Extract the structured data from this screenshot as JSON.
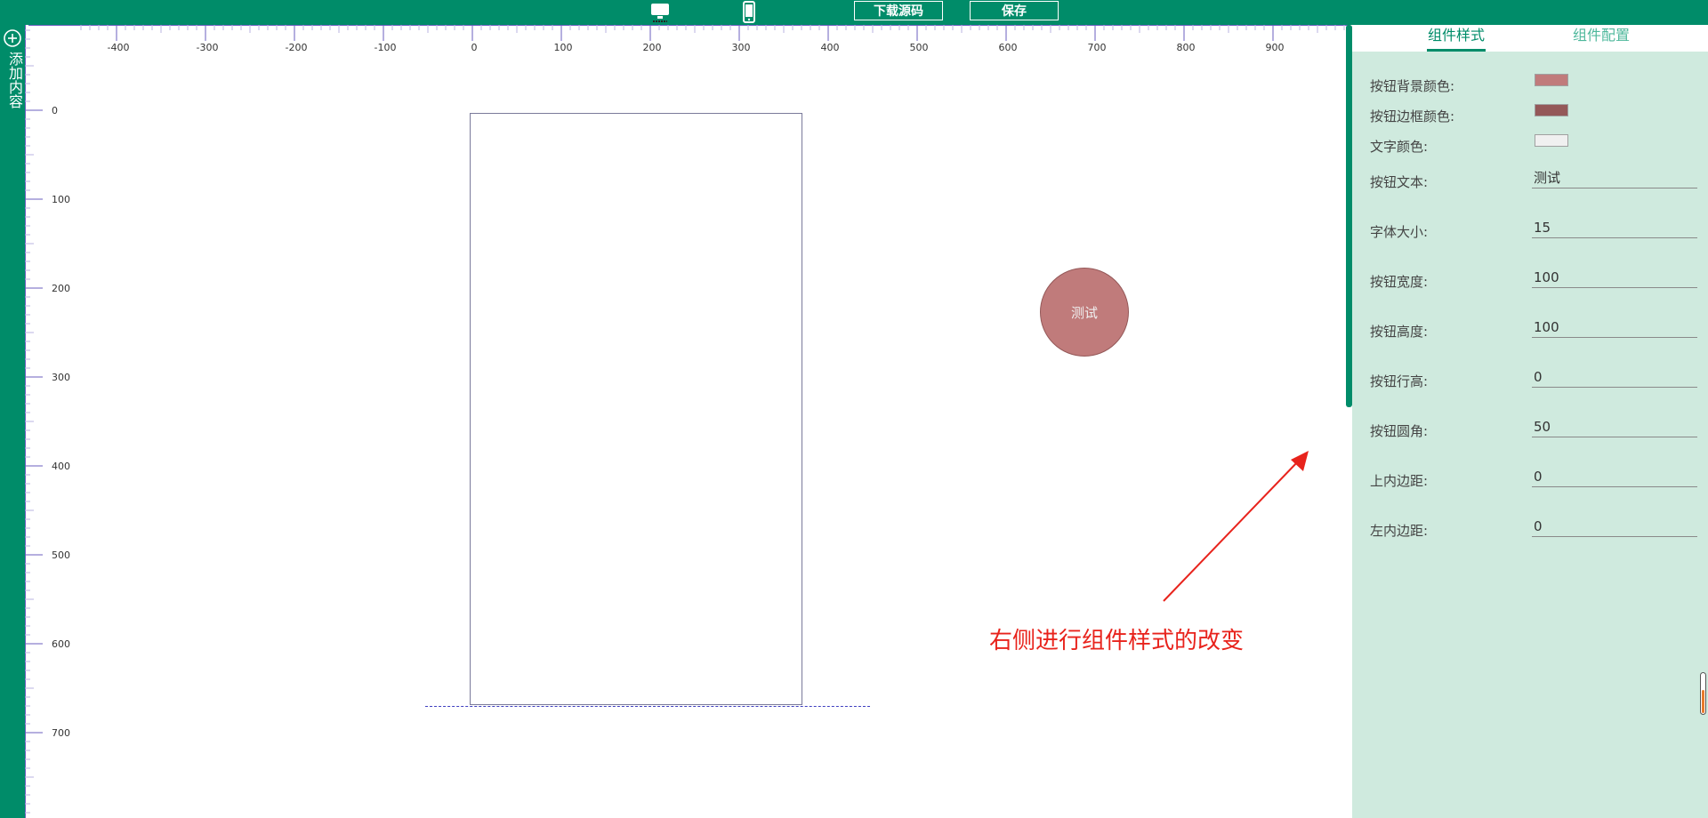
{
  "toolbar": {
    "desktop_icon": "monitor-icon",
    "mobile_icon": "mobile-phone-icon",
    "download_label": "下载源码",
    "save_label": "保存"
  },
  "sidebar": {
    "add_icon": "plus-circle-icon",
    "add_label": "添加内容"
  },
  "ruler": {
    "horizontal_ticks": [
      "-400",
      "-300",
      "-200",
      "-100",
      "0",
      "100",
      "200",
      "300",
      "400",
      "500",
      "600",
      "700",
      "800",
      "900"
    ],
    "vertical_ticks": [
      "0",
      "100",
      "200",
      "300",
      "400",
      "500",
      "600",
      "700"
    ]
  },
  "canvas": {
    "button_text": "测试",
    "annotation": "右侧进行组件样式的改变"
  },
  "panel": {
    "tabs": [
      {
        "label": "组件样式",
        "active": true
      },
      {
        "label": "组件配置",
        "active": false
      }
    ],
    "colors": [
      {
        "label": "按钮背景颜色:",
        "value": "#c07b7b"
      },
      {
        "label": "按钮边框颜色:",
        "value": "#945858"
      },
      {
        "label": "文字颜色:",
        "value": "#f0f0f0"
      }
    ],
    "fields": [
      {
        "label": "按钮文本:",
        "value": "测试"
      },
      {
        "label": "字体大小:",
        "value": "15"
      },
      {
        "label": "按钮宽度:",
        "value": "100"
      },
      {
        "label": "按钮高度:",
        "value": "100"
      },
      {
        "label": "按钮行高:",
        "value": "0"
      },
      {
        "label": "按钮圆角:",
        "value": "50"
      },
      {
        "label": "上内边距:",
        "value": "0"
      },
      {
        "label": "左内边距:",
        "value": "0"
      }
    ]
  }
}
